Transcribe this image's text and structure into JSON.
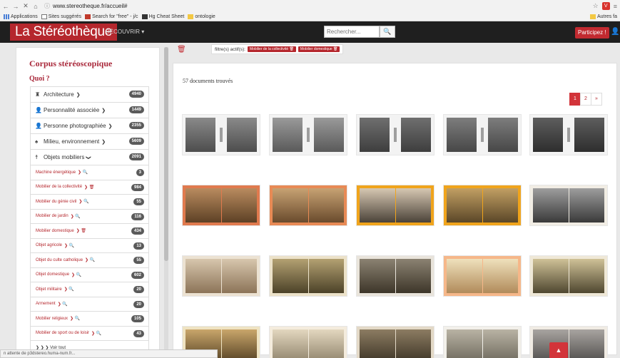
{
  "browser": {
    "url": "www.stereotheque.fr/accueil#",
    "bookmarks": [
      "Applications",
      "Sites suggérés",
      "Search for \"free\" - j/c",
      "Hg Cheat Sheet",
      "ontologie"
    ],
    "bookmarks_right": "Autres fa"
  },
  "header": {
    "logo": "La Stéréothèque",
    "discover": "DÉCOUVRIR ▾",
    "search_placeholder": "Rechercher...",
    "participate": "Participez !"
  },
  "filters": {
    "label": "filtre(s) actif(s):",
    "active": [
      "Mobilier de la collectivité 🗑",
      "Mobilier domestique 🗑"
    ]
  },
  "sidebar": {
    "title": "Corpus stéréoscopique",
    "subtitle": "Quoi ?",
    "categories": [
      {
        "icon": "♜",
        "label": "Architecture",
        "arrow": "❯",
        "count": "4940"
      },
      {
        "icon": "👤",
        "label": "Personnalité associée",
        "arrow": "❯",
        "count": "1449"
      },
      {
        "icon": "👤",
        "label": "Personne photographiée",
        "arrow": "❯",
        "count": "2355"
      },
      {
        "icon": "♠",
        "label": "Milieu, environnement",
        "arrow": "❯",
        "count": "5609"
      },
      {
        "icon": "☨",
        "label": "Objets mobiliers",
        "arrow": "❯",
        "count": "2091"
      }
    ],
    "subitems": [
      {
        "label": "Machine énergétique",
        "icon": "❯ 🔍",
        "count": "3"
      },
      {
        "label": "Mobilier de la collectivité",
        "icon": "❯ 🗑",
        "count": "984"
      },
      {
        "label": "Mobilier du génie civil",
        "icon": "❯ 🔍",
        "count": "55"
      },
      {
        "label": "Mobilier de jardin",
        "icon": "❯ 🔍",
        "count": "116"
      },
      {
        "label": "Mobilier domestique",
        "icon": "❯ 🗑",
        "count": "434"
      },
      {
        "label": "Objet agricole",
        "icon": "❯ 🔍",
        "count": "13"
      },
      {
        "label": "Objet du culte catholique",
        "icon": "❯ 🔍",
        "count": "55"
      },
      {
        "label": "Objet domestique",
        "icon": "❯ 🔍",
        "count": "602"
      },
      {
        "label": "Objet militaire",
        "icon": "❯ 🔍",
        "count": "20"
      },
      {
        "label": "Armement",
        "icon": "❯ 🔍",
        "count": "20"
      },
      {
        "label": "Mobilier religieux",
        "icon": "❯ 🔍",
        "count": "105"
      },
      {
        "label": "Mobilier de sport ou de loisir",
        "icon": "❯ 🔍",
        "count": "43"
      }
    ],
    "see_all": "❯ ❯ ❯ Voir tout"
  },
  "main": {
    "count": "57 documents trouvés",
    "pages": [
      "1",
      "2",
      "»"
    ],
    "active_page": "1",
    "thumbnails": [
      {
        "bg": "#f3f3f3",
        "a": "#8a8a8a",
        "b": "#4d4d4d",
        "mid": true
      },
      {
        "bg": "#f3f3f3",
        "a": "#9a9a9a",
        "b": "#5a5a5a",
        "mid": true
      },
      {
        "bg": "#f3f3f3",
        "a": "#6f6f6f",
        "b": "#3e3e3e",
        "mid": true
      },
      {
        "bg": "#f3f3f3",
        "a": "#7d7d7d",
        "b": "#474747",
        "mid": true
      },
      {
        "bg": "#f3f3f3",
        "a": "#5e5e5e",
        "b": "#2e2e2e",
        "mid": true
      },
      {
        "bg": "#e07a4e",
        "a": "#b98b5f",
        "b": "#5d4125",
        "mid": false
      },
      {
        "bg": "#e88a55",
        "a": "#c7a273",
        "b": "#6a4b2d",
        "mid": false
      },
      {
        "bg": "#f0a41c",
        "a": "#d6c7b2",
        "b": "#4b4339",
        "mid": false
      },
      {
        "bg": "#f0a41c",
        "a": "#c19f63",
        "b": "#5b4728",
        "mid": false
      },
      {
        "bg": "#f1ede4",
        "a": "#9d9d9d",
        "b": "#3a3a3a",
        "mid": false
      },
      {
        "bg": "#ece2d2",
        "a": "#d7c6ad",
        "b": "#8c7458",
        "mid": false
      },
      {
        "bg": "#ece2c9",
        "a": "#b3a172",
        "b": "#4c4228",
        "mid": false
      },
      {
        "bg": "#e9e4db",
        "a": "#8b8272",
        "b": "#3d3629",
        "mid": false
      },
      {
        "bg": "#f6b789",
        "a": "#efe1bc",
        "b": "#b18b5b",
        "mid": false
      },
      {
        "bg": "#efe8d7",
        "a": "#cfc197",
        "b": "#4f4730",
        "mid": false
      },
      {
        "bg": "#efe3c2",
        "a": "#c9a66b",
        "b": "#4f3c20",
        "mid": false
      },
      {
        "bg": "#f4ecdd",
        "a": "#e3d7bf",
        "b": "#8c8068",
        "mid": false
      },
      {
        "bg": "#e3d9c7",
        "a": "#8c7c62",
        "b": "#3a3224",
        "mid": false
      },
      {
        "bg": "#f2f0ea",
        "a": "#b9b3a4",
        "b": "#6b665a",
        "mid": false
      },
      {
        "bg": "#f0ebe3",
        "a": "#a8a4a0",
        "b": "#4c4a48",
        "mid": false
      }
    ]
  },
  "status_text": "n attente de p3dstereo.huma-num.fr...",
  "to_top_icon": "chevron-up-icon"
}
